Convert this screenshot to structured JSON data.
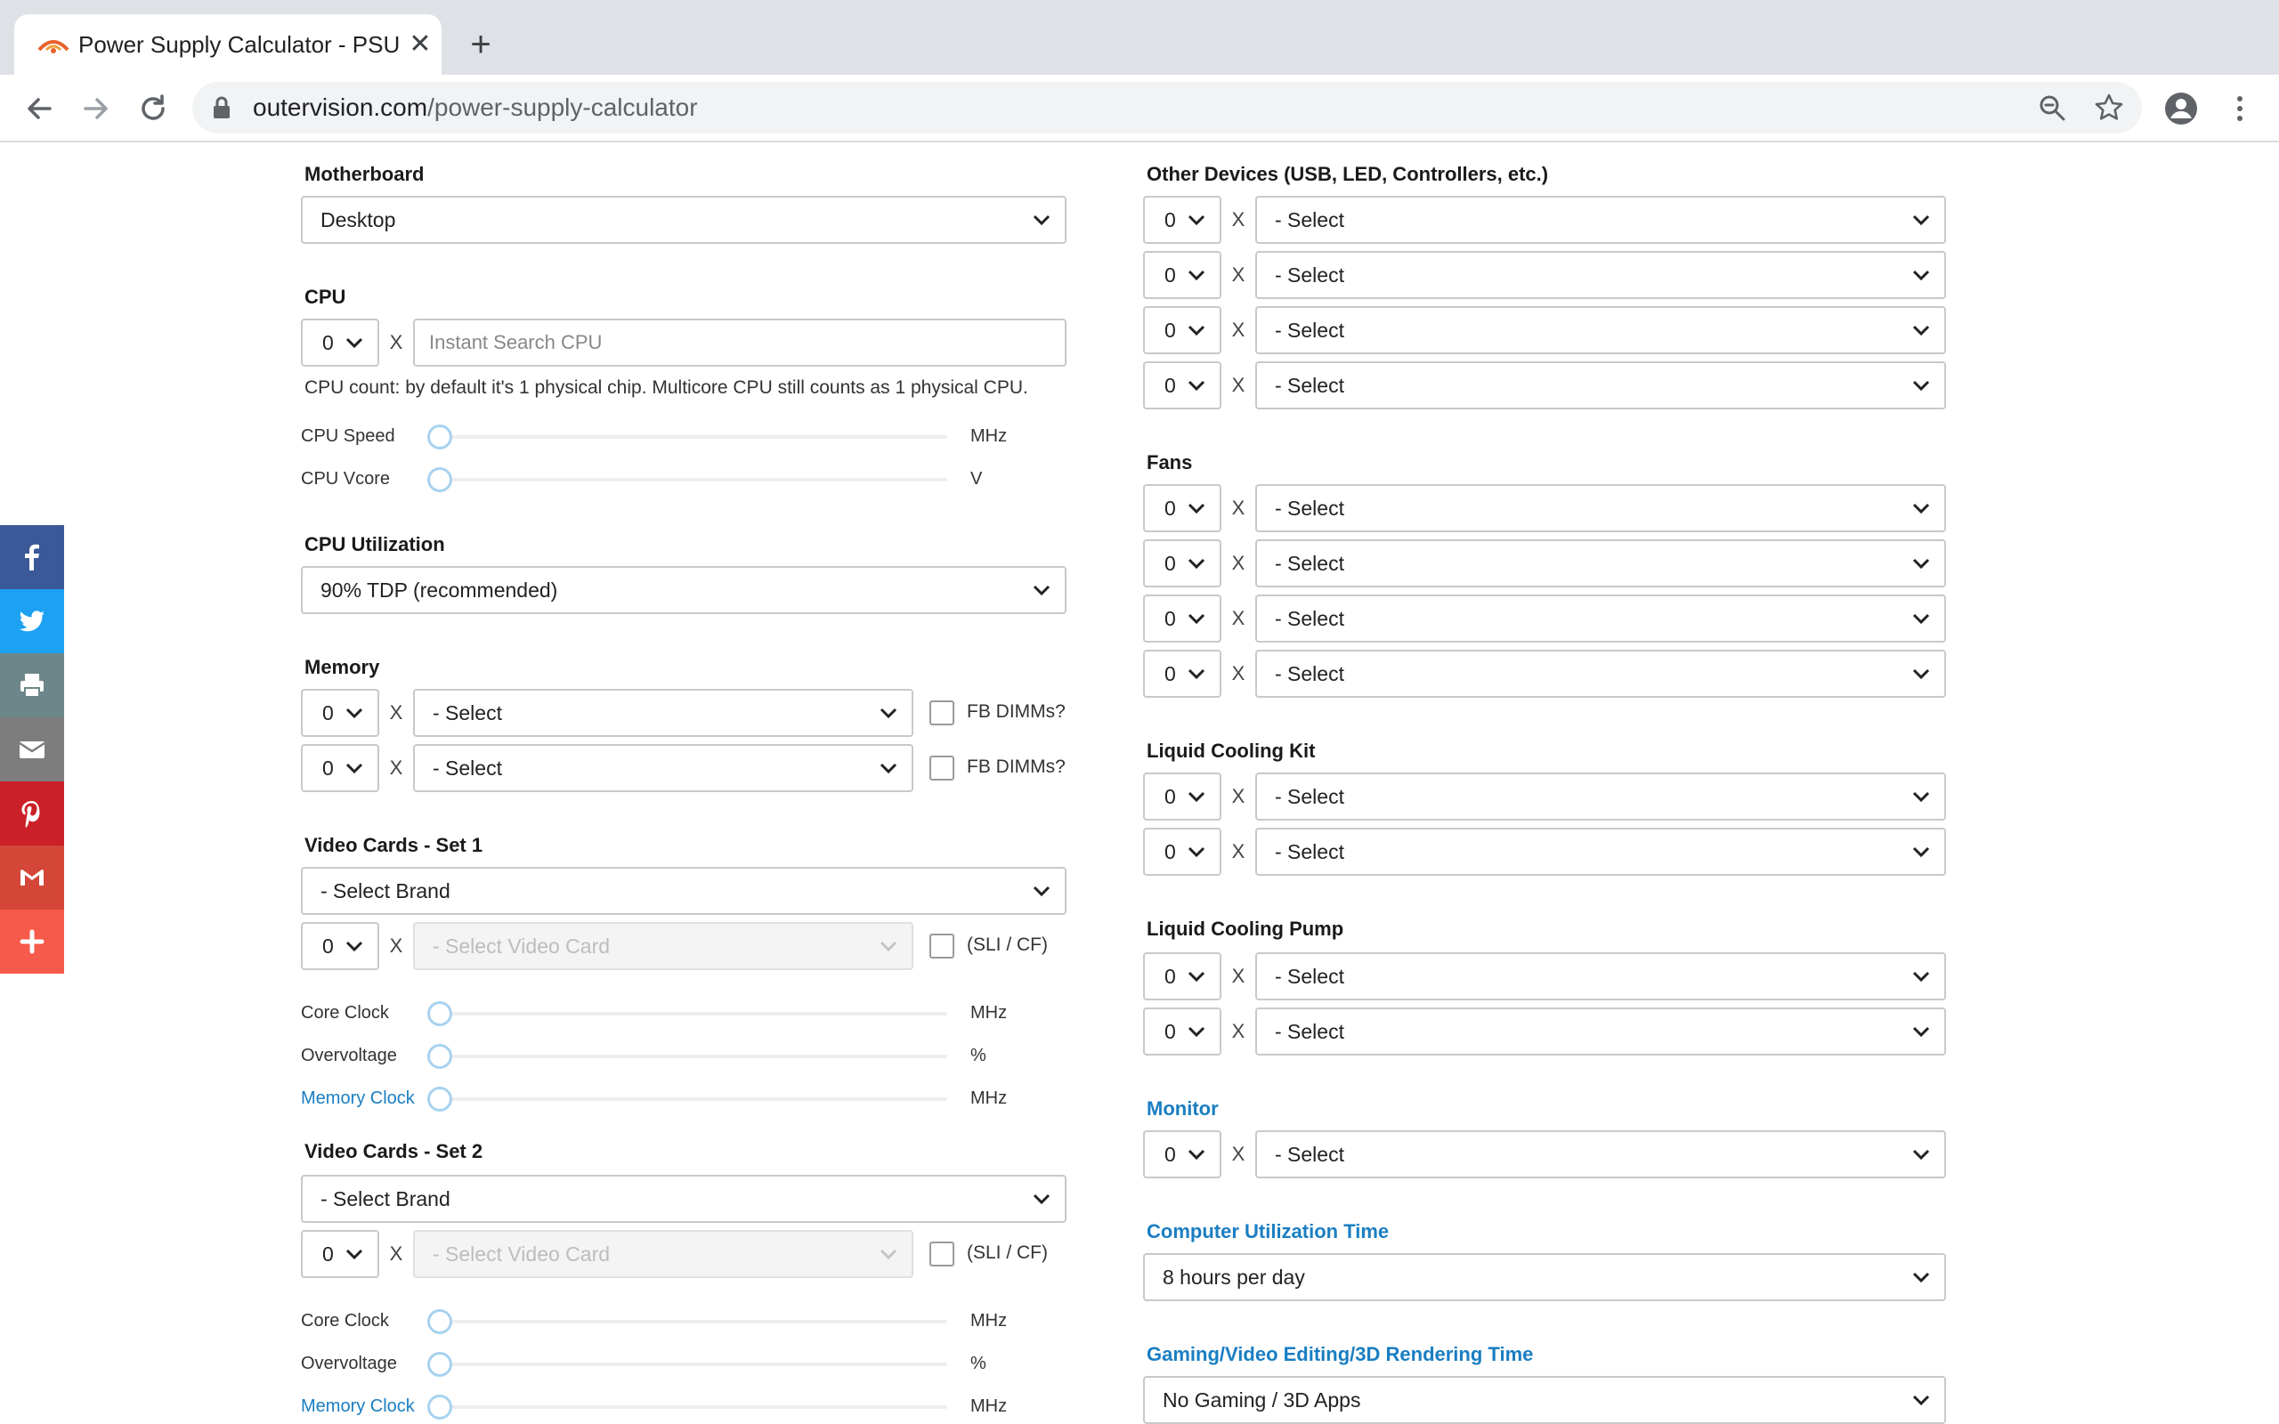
{
  "browser": {
    "tab_title": "Power Supply Calculator - PSU",
    "tab_close": "✕",
    "new_tab": "+",
    "url_host": "outervision.com",
    "url_path": "/power-supply-calculator"
  },
  "share": [
    "facebook-icon",
    "twitter-icon",
    "print-icon",
    "email-icon",
    "pinterest-icon",
    "gmail-icon",
    "more-icon"
  ],
  "colors": {
    "facebook": "#3b5998",
    "twitter": "#1da1f2",
    "print": "#6d8689",
    "email": "#7d7d7d",
    "pinterest": "#cb2027",
    "gmail": "#d44638",
    "more": "#f65a4a",
    "link": "#1a7ec2"
  },
  "left": {
    "motherboard": {
      "label": "Motherboard",
      "value": "Desktop"
    },
    "cpu": {
      "label": "CPU",
      "count": "0",
      "x": "X",
      "search_placeholder": "Instant Search CPU",
      "note": "CPU count: by default it's 1 physical chip. Multicore CPU still counts as 1 physical CPU.",
      "speed_label": "CPU Speed",
      "speed_unit": "MHz",
      "vcore_label": "CPU Vcore",
      "vcore_unit": "V"
    },
    "utilization": {
      "label": "CPU Utilization",
      "value": "90% TDP (recommended)"
    },
    "memory": {
      "label": "Memory",
      "rows": [
        {
          "count": "0",
          "x": "X",
          "value": "- Select",
          "checkbox": "FB DIMMs?"
        },
        {
          "count": "0",
          "x": "X",
          "value": "- Select",
          "checkbox": "FB DIMMs?"
        }
      ]
    },
    "video1": {
      "label": "Video Cards - Set 1",
      "brand": "- Select Brand",
      "count": "0",
      "x": "X",
      "card": "- Select Video Card",
      "sli": "(SLI / CF)",
      "core_clock": "Core Clock",
      "core_unit": "MHz",
      "overvoltage": "Overvoltage",
      "over_unit": "%",
      "mem_clock": "Memory Clock",
      "mem_unit": "MHz"
    },
    "video2": {
      "label": "Video Cards - Set 2",
      "brand": "- Select Brand",
      "count": "0",
      "x": "X",
      "card": "- Select Video Card",
      "sli": "(SLI / CF)",
      "core_clock": "Core Clock",
      "core_unit": "MHz",
      "overvoltage": "Overvoltage",
      "over_unit": "%",
      "mem_clock": "Memory Clock",
      "mem_unit": "MHz"
    }
  },
  "right": {
    "other_devices": {
      "label": "Other Devices (USB, LED, Controllers, etc.)",
      "rows": [
        {
          "count": "0",
          "x": "X",
          "value": "- Select"
        },
        {
          "count": "0",
          "x": "X",
          "value": "- Select"
        },
        {
          "count": "0",
          "x": "X",
          "value": "- Select"
        },
        {
          "count": "0",
          "x": "X",
          "value": "- Select"
        }
      ]
    },
    "fans": {
      "label": "Fans",
      "rows": [
        {
          "count": "0",
          "x": "X",
          "value": "- Select"
        },
        {
          "count": "0",
          "x": "X",
          "value": "- Select"
        },
        {
          "count": "0",
          "x": "X",
          "value": "- Select"
        },
        {
          "count": "0",
          "x": "X",
          "value": "- Select"
        }
      ]
    },
    "cooling_kit": {
      "label": "Liquid Cooling Kit",
      "rows": [
        {
          "count": "0",
          "x": "X",
          "value": "- Select"
        },
        {
          "count": "0",
          "x": "X",
          "value": "- Select"
        }
      ]
    },
    "cooling_pump": {
      "label": "Liquid Cooling Pump",
      "rows": [
        {
          "count": "0",
          "x": "X",
          "value": "- Select"
        },
        {
          "count": "0",
          "x": "X",
          "value": "- Select"
        }
      ]
    },
    "monitor": {
      "label": "Monitor",
      "rows": [
        {
          "count": "0",
          "x": "X",
          "value": "- Select"
        }
      ]
    },
    "util_time": {
      "label": "Computer Utilization Time",
      "value": "8 hours per day"
    },
    "gaming_time": {
      "label": "Gaming/Video Editing/3D Rendering Time",
      "value": "No Gaming / 3D Apps"
    }
  }
}
